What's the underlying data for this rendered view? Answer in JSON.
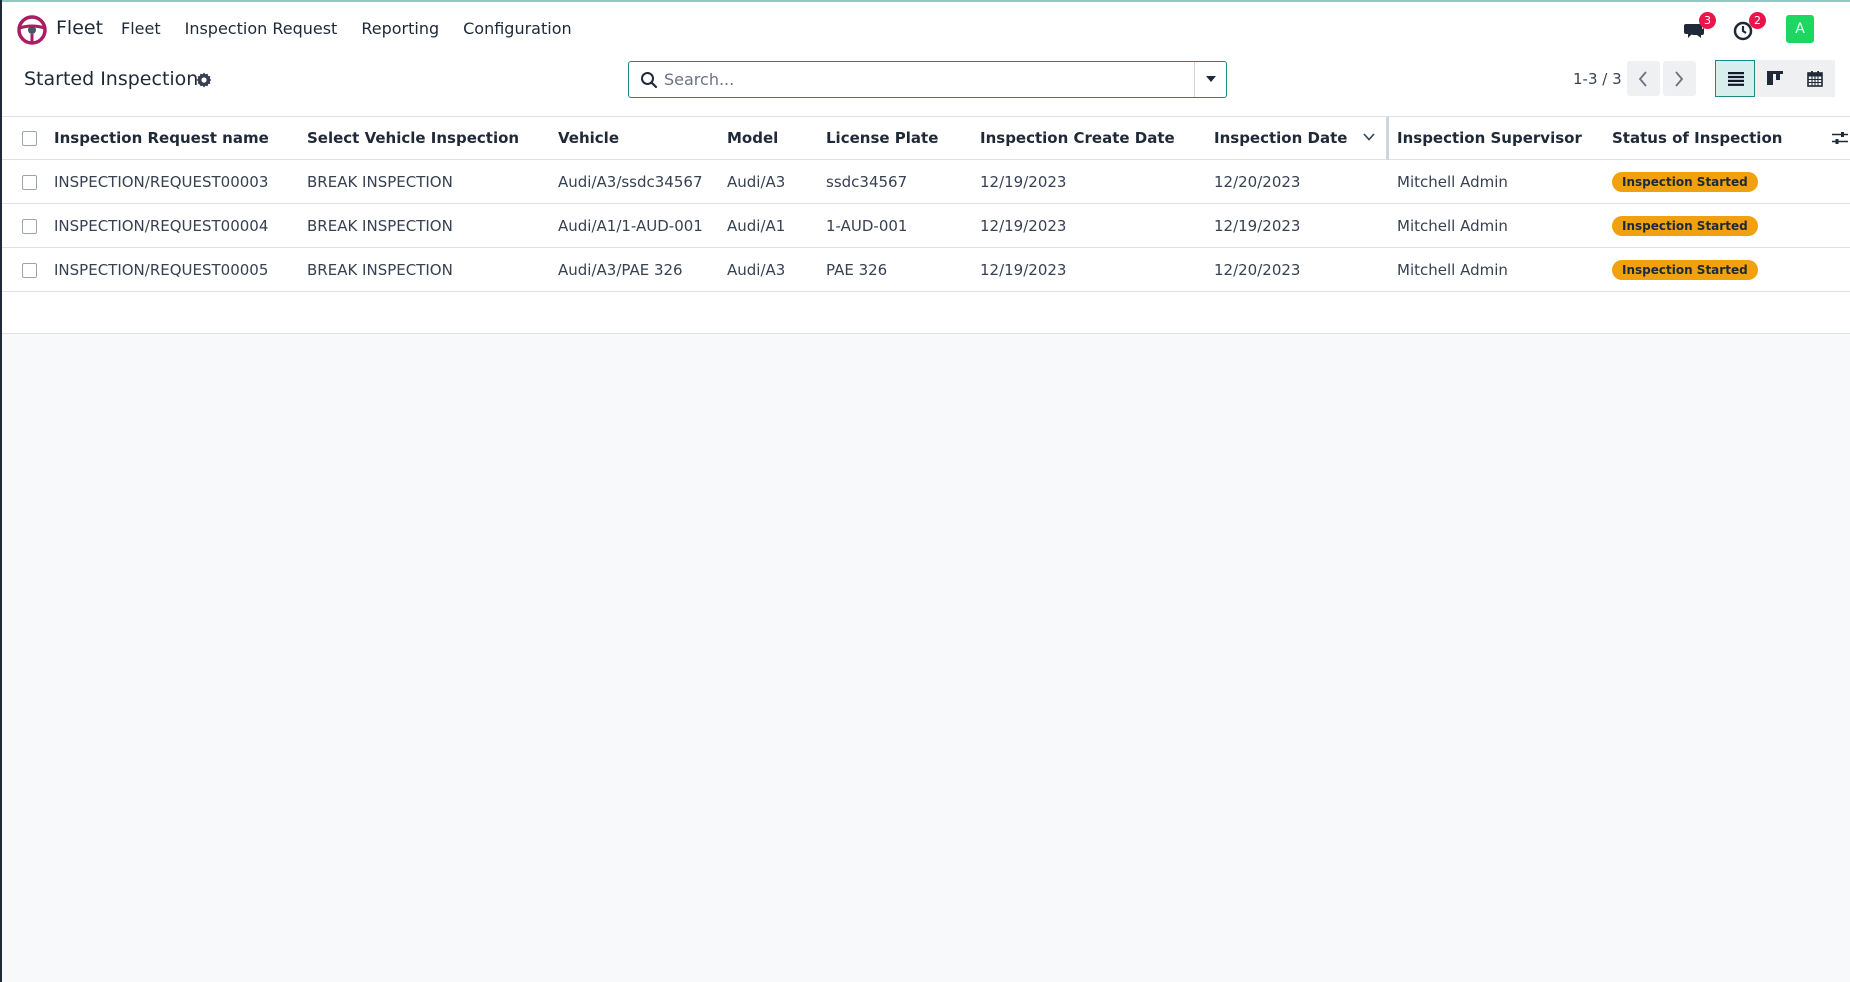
{
  "navbar": {
    "app_name": "Fleet",
    "menu": [
      "Fleet",
      "Inspection Request",
      "Reporting",
      "Configuration"
    ],
    "messages_count": "3",
    "activities_count": "2",
    "avatar_letter": "A",
    "brand_color": "#a91e63"
  },
  "control_panel": {
    "title": "Started Inspections",
    "search_placeholder": "Search...",
    "pager_value": "1-3 / 3"
  },
  "table": {
    "columns": [
      "Inspection Request name",
      "Select Vehicle Inspection",
      "Vehicle",
      "Model",
      "License Plate",
      "Inspection Create Date",
      "Inspection Date",
      "Inspection Supervisor",
      "Status of Inspection"
    ],
    "rows": [
      [
        "INSPECTION/REQUEST00003",
        "BREAK INSPECTION",
        "Audi/A3/ssdc34567",
        "Audi/A3",
        "ssdc34567",
        "12/19/2023",
        "12/20/2023",
        "Mitchell Admin",
        "Inspection Started"
      ],
      [
        "INSPECTION/REQUEST00004",
        "BREAK INSPECTION",
        "Audi/A1/1-AUD-001",
        "Audi/A1",
        "1-AUD-001",
        "12/19/2023",
        "12/19/2023",
        "Mitchell Admin",
        "Inspection Started"
      ],
      [
        "INSPECTION/REQUEST00005",
        "BREAK INSPECTION",
        "Audi/A3/PAE 326",
        "Audi/A3",
        "PAE 326",
        "12/19/2023",
        "12/20/2023",
        "Mitchell Admin",
        "Inspection Started"
      ]
    ],
    "status_color": "#f1a00f"
  }
}
